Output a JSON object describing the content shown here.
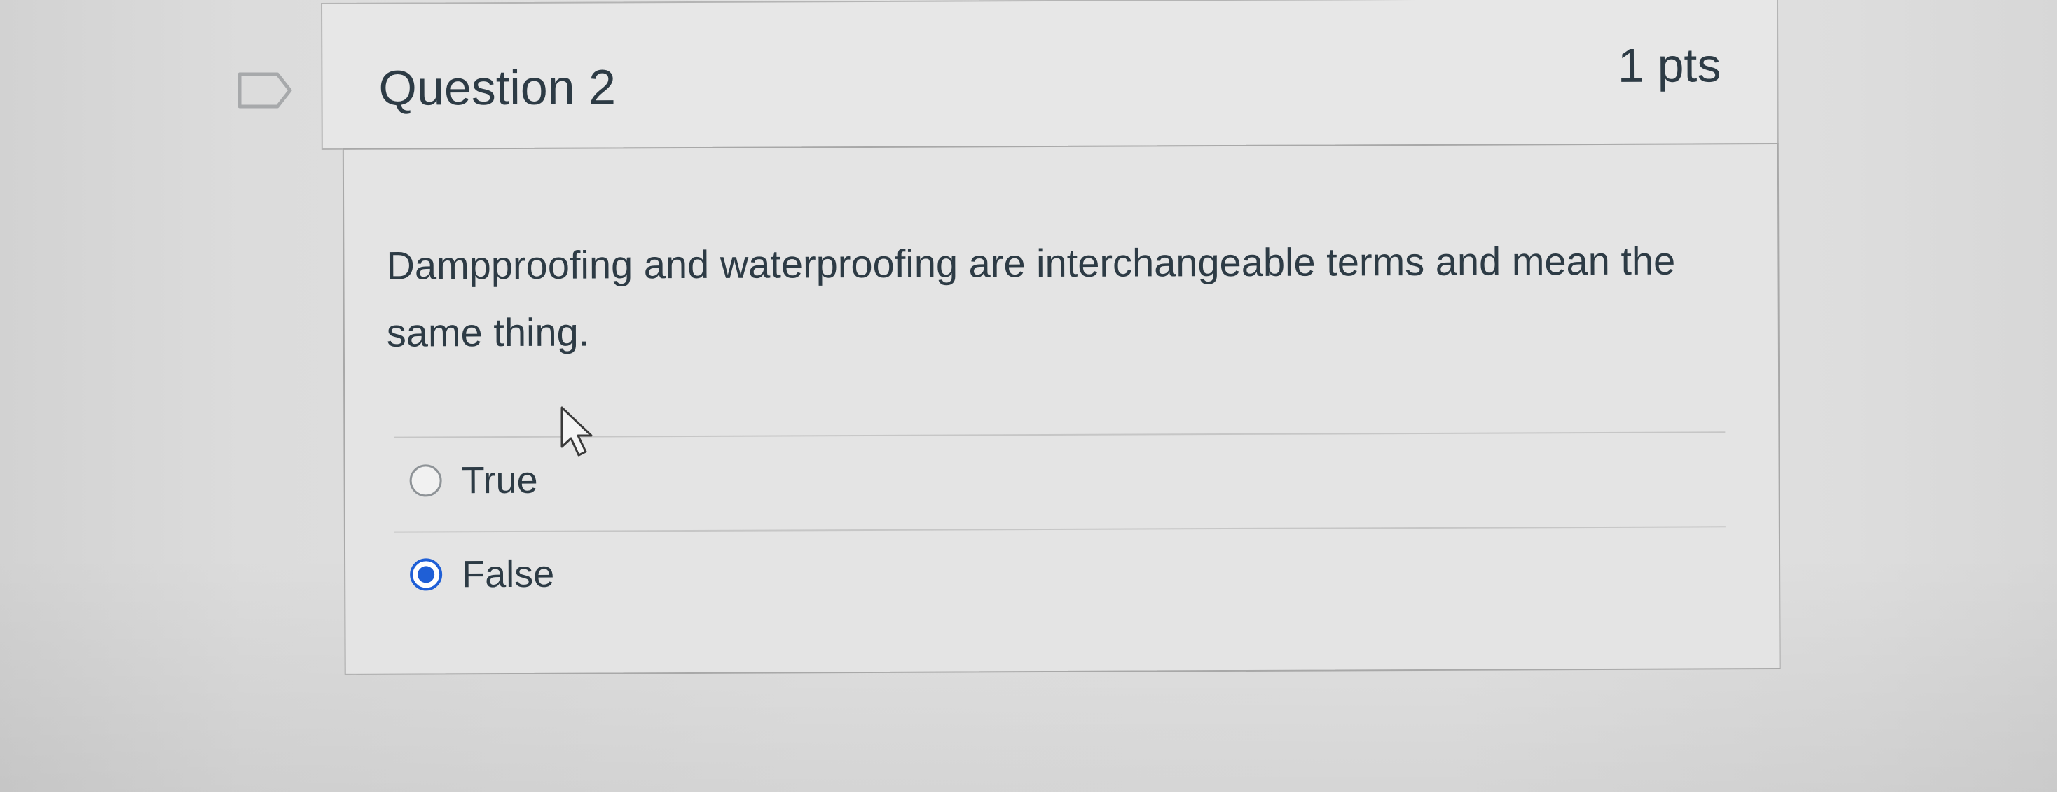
{
  "question": {
    "title": "Question 2",
    "points": "1 pts",
    "text": "Dampproofing and waterproofing are interchangeable terms and mean the same thing.",
    "answers": [
      {
        "label": "True",
        "selected": false
      },
      {
        "label": "False",
        "selected": true
      }
    ]
  },
  "icons": {
    "flag": "flag-question-icon",
    "cursor": "mouse-pointer-icon"
  },
  "colors": {
    "text": "#2d3b45",
    "selected_radio": "#1f5fd6",
    "header_bg": "#e7e7e7",
    "border": "#b4b4b4"
  }
}
